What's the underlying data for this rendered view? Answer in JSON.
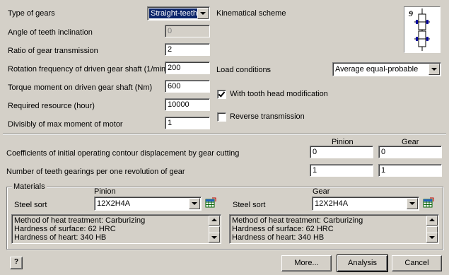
{
  "gear_type": {
    "label": "Type of gears",
    "value": "Straight-teeth"
  },
  "kinematic_scheme": {
    "label": "Kinematical scheme",
    "number": "9"
  },
  "angle": {
    "label": "Angle of teeth inclination",
    "value": "0"
  },
  "ratio": {
    "label": "Ratio of gear transmission",
    "value": "2"
  },
  "rotation": {
    "label": "Rotation frequency of driven gear shaft (1/min)",
    "value": "200"
  },
  "torque": {
    "label": "Torque moment on driven gear shaft (Nm)",
    "value": "600"
  },
  "resource": {
    "label": "Required resource (hour)",
    "value": "10000"
  },
  "divisibly": {
    "label": "Divisibly of max moment of motor",
    "value": "1"
  },
  "load": {
    "label": "Load conditions",
    "value": "Average equal-probable"
  },
  "tooth_head": {
    "label": "With tooth head modification",
    "checked": true
  },
  "reverse": {
    "label": "Reverse transmission",
    "checked": false
  },
  "columns": {
    "pinion": "Pinion",
    "gear": "Gear"
  },
  "coeff": {
    "label": "Coefficients of initial operating contour displacement by gear cutting",
    "pinion": "0",
    "gear": "0"
  },
  "teeth": {
    "label": "Number of teeth gearings per one revolution of gear",
    "pinion": "1",
    "gear": "1"
  },
  "materials": {
    "title": "Materials",
    "pinion": {
      "header": "Pinion",
      "steel_label": "Steel sort",
      "steel": "12X2H4A",
      "info": [
        "Method of heat treatment: Carburizing",
        "Hardness of surface: 62 HRC",
        "Hardness of heart: 340 HB"
      ]
    },
    "gear": {
      "header": "Gear",
      "steel_label": "Steel sort",
      "steel": "12X2H4A",
      "info": [
        "Method of heat treatment: Carburizing",
        "Hardness of surface: 62 HRC",
        "Hardness of heart: 340 HB"
      ]
    }
  },
  "buttons": {
    "more": "More...",
    "analysis": "Analysis",
    "cancel": "Cancel"
  },
  "icons": {
    "help": "help-icon",
    "table_pinion": "table-icon",
    "table_gear": "table-icon"
  }
}
